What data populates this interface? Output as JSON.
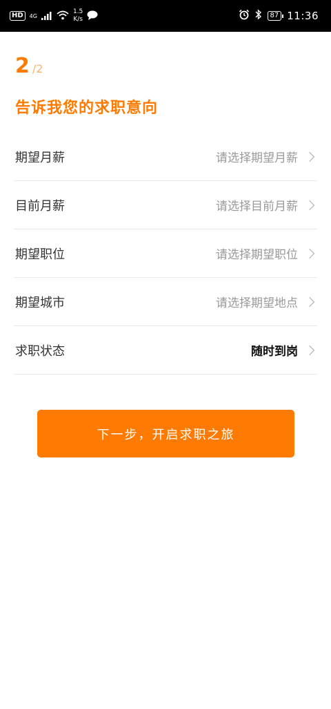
{
  "status_bar": {
    "hd": "HD",
    "network": "4G",
    "speed_value": "1.5",
    "speed_unit": "K/s",
    "battery": "87",
    "time": "11:36"
  },
  "step": {
    "current": "2",
    "total": "/2"
  },
  "title": "告诉我您的求职意向",
  "rows": [
    {
      "label": "期望月薪",
      "value": "请选择期望月薪"
    },
    {
      "label": "目前月薪",
      "value": "请选择目前月薪"
    },
    {
      "label": "期望职位",
      "value": "请选择期望职位"
    },
    {
      "label": "期望城市",
      "value": "请选择期望地点"
    },
    {
      "label": "求职状态",
      "value": "随时到岗"
    }
  ],
  "next_button": "下一步，开启求职之旅",
  "colors": {
    "accent": "#ff7a00",
    "placeholder": "#999999",
    "value_set": "#111111"
  }
}
